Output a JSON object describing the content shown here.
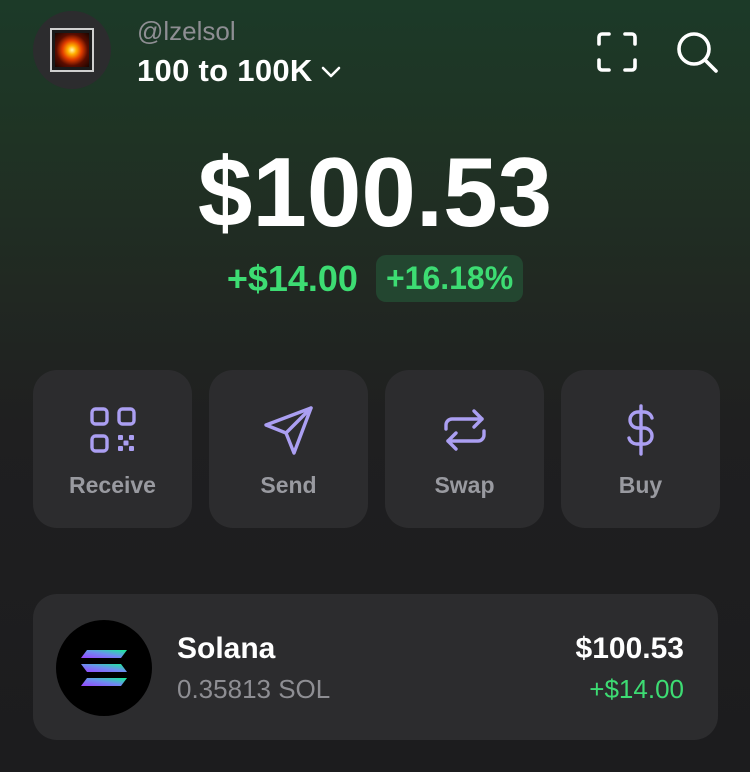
{
  "header": {
    "handle": "@lzelsol",
    "account_name": "100 to 100K",
    "icons": [
      "scan-icon",
      "search-icon",
      "chevron-down-icon"
    ]
  },
  "balance": {
    "total": "$100.53",
    "change_abs": "+$14.00",
    "change_pct": "+16.18%"
  },
  "actions": [
    {
      "label": "Receive",
      "icon": "qr-code-icon"
    },
    {
      "label": "Send",
      "icon": "send-icon"
    },
    {
      "label": "Swap",
      "icon": "swap-icon"
    },
    {
      "label": "Buy",
      "icon": "dollar-icon"
    }
  ],
  "tokens": [
    {
      "name": "Solana",
      "amount": "0.35813 SOL",
      "value": "$100.53",
      "change": "+$14.00",
      "icon": "solana-logo-icon"
    }
  ],
  "colors": {
    "positive": "#3ddc73",
    "accent": "#ab9ff2",
    "card": "#2c2c2e",
    "muted": "#8e8e93"
  }
}
